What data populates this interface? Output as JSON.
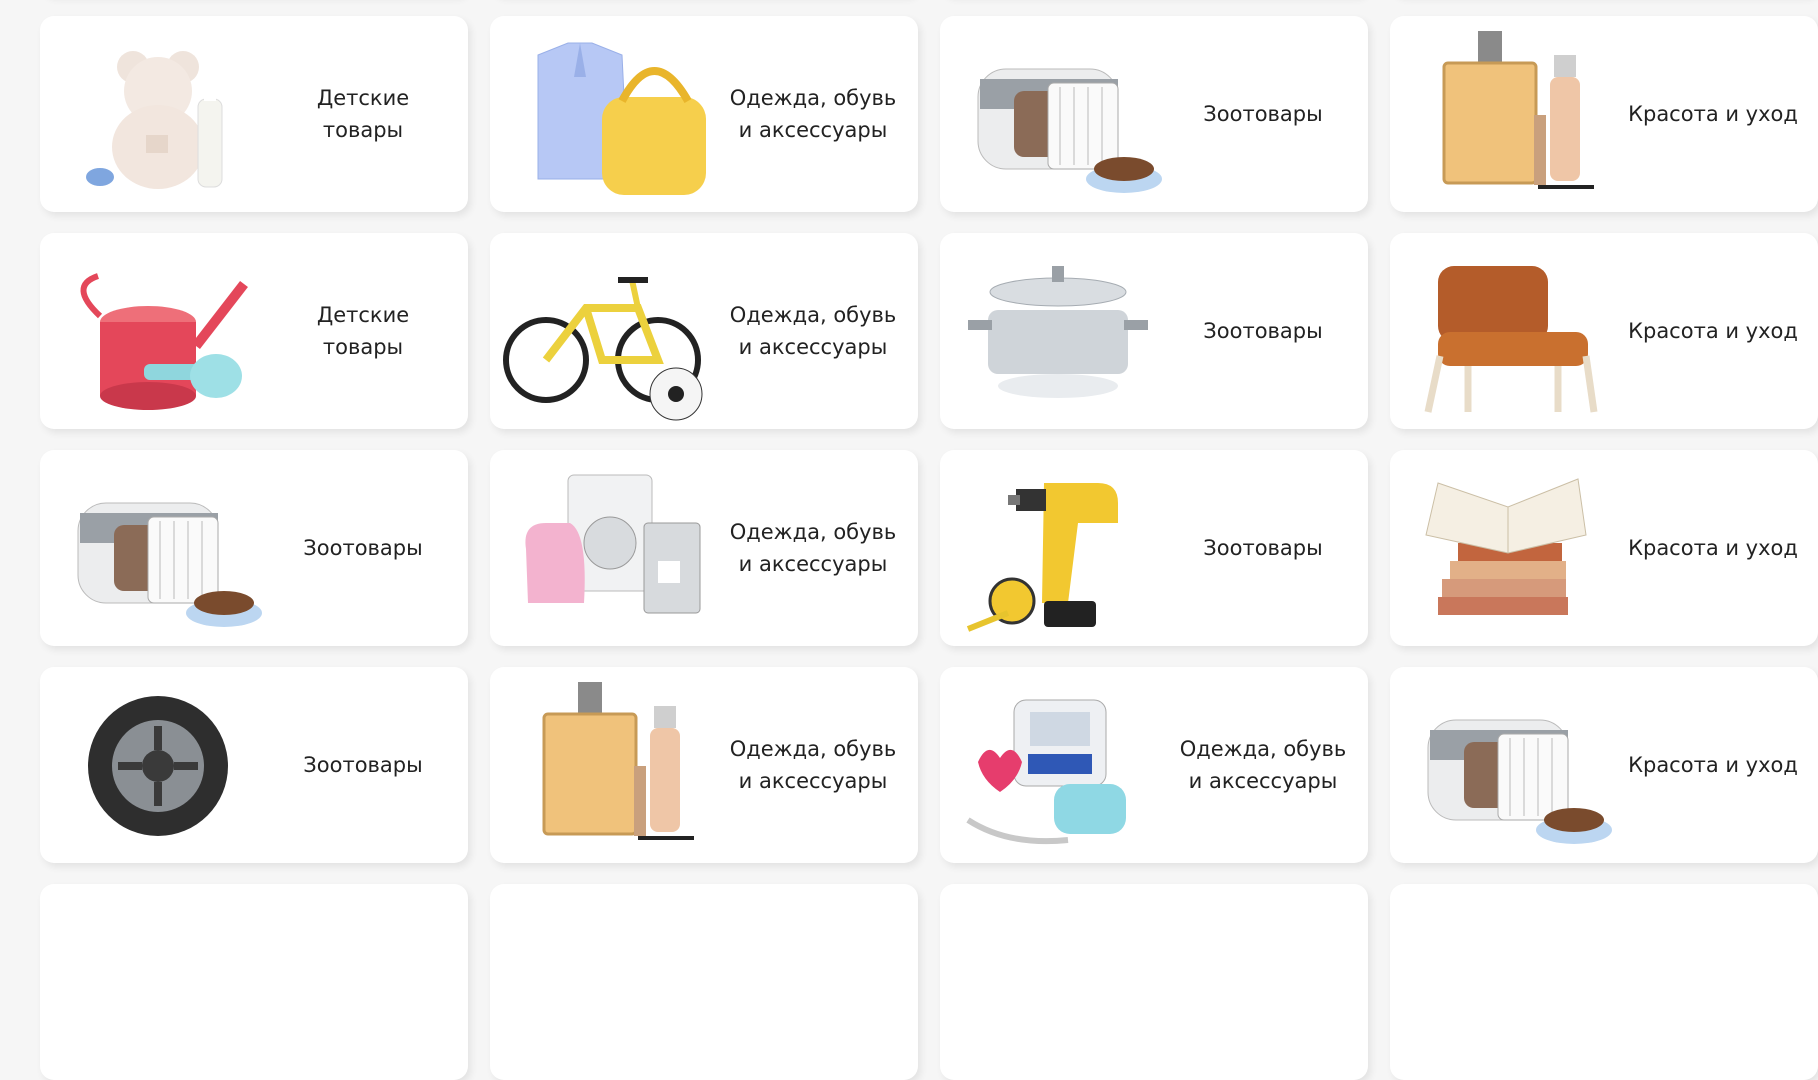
{
  "grid": {
    "rows": [
      [
        "",
        "",
        "",
        ""
      ],
      [
        "Детские товары",
        "Одежда, обувь и аксессуары",
        "Зоотовары",
        "Красота и уход"
      ],
      [
        "Детские товары",
        "Одежда, обувь и аксессуары",
        "Зоотовары",
        "Красота и уход"
      ],
      [
        "Зоотовары",
        "Одежда, обувь и аксессуары",
        "Зоотовары",
        "Красота и уход"
      ],
      [
        "Зоотовары",
        "Одежда, обувь и аксессуары",
        "Одежда, обувь и аксессуары",
        "Красота и уход"
      ],
      [
        "",
        "",
        "",
        ""
      ]
    ],
    "icons": [
      [
        "",
        "",
        "",
        ""
      ],
      [
        "teddy-bear-icon",
        "clothing-bag-icon",
        "pet-carrier-icon",
        "perfume-icon"
      ],
      [
        "watering-can-icon",
        "bicycle-ball-icon",
        "cooking-pot-icon",
        "armchair-icon"
      ],
      [
        "pet-carrier-icon",
        "appliances-icon",
        "drill-tape-icon",
        "books-icon"
      ],
      [
        "tire-icon",
        "perfume-icon",
        "blood-pressure-monitor-icon",
        "pet-carrier-icon"
      ],
      [
        "",
        "",
        "",
        ""
      ]
    ]
  },
  "colors": {
    "background": "#f6f6f6",
    "card": "#ffffff"
  }
}
